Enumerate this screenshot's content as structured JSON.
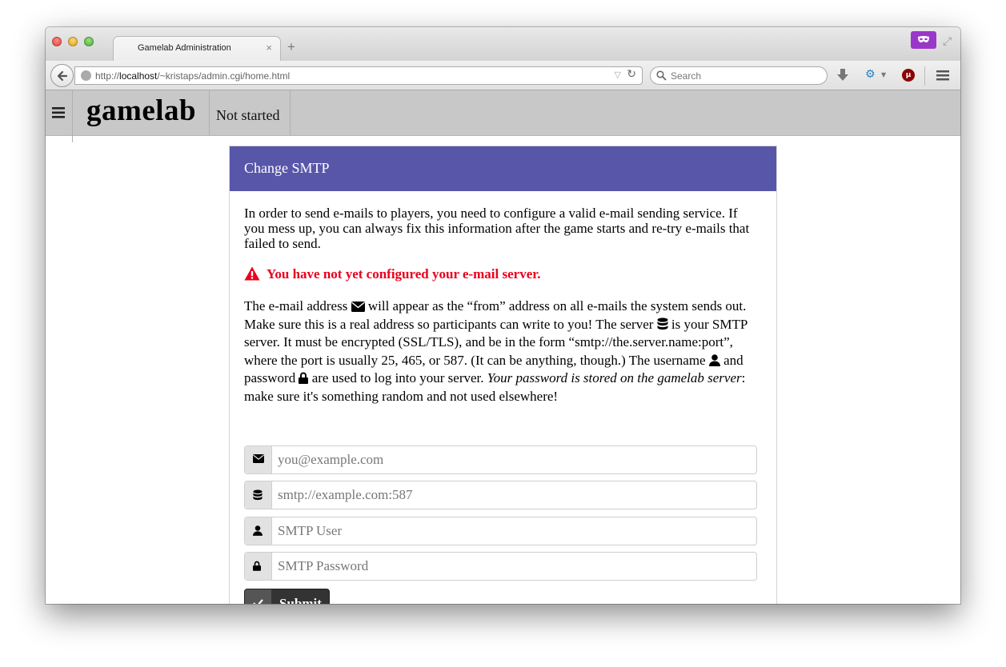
{
  "browser": {
    "tab_title": "Gamelab Administration",
    "tab_close": "×",
    "new_tab": "+",
    "url_prefix": "http://",
    "url_host": "localhost",
    "url_path": "/~kristaps/admin.cgi/home.html",
    "search_placeholder": "Search",
    "reload_glyph": "↻",
    "url_dropdown_glyph": "▽"
  },
  "app": {
    "title": "gamelab",
    "status": "Not started"
  },
  "panel": {
    "title": "Change SMTP",
    "intro": "In order to send e-mails to players, you need to configure a valid e-mail sending service. If you mess up, you can always fix this information after the game starts and re-try e-mails that failed to send.",
    "warning": "You have not yet configured your e-mail server.",
    "explain": {
      "p1": "The e-mail address",
      "p2": "will appear as the “from” address on all e-mails the system sends out. Make sure this is a real address so participants can write to you! The server",
      "p3": "is your SMTP server. It must be encrypted (SSL/TLS), and be in the form “smtp://the.server.name:port”, where the port is usually 25, 465, or 587. (It can be anything, though.) The username",
      "p4": "and password",
      "p5": "are used to log into your server.",
      "emph": "Your password is stored on the gamelab server",
      "p6": ": make sure it's something random and not used elsewhere!"
    },
    "fields": {
      "email": {
        "placeholder": "you@example.com",
        "value": "",
        "icon": "envelope-icon"
      },
      "server": {
        "placeholder": "smtp://example.com:587",
        "value": "",
        "icon": "database-icon"
      },
      "user": {
        "placeholder": "SMTP User",
        "value": "",
        "icon": "user-icon"
      },
      "password": {
        "placeholder": "SMTP Password",
        "value": "",
        "icon": "lock-icon"
      }
    },
    "submit_label": "Submit"
  },
  "colors": {
    "panel_header": "#5856a9",
    "warning": "#e8001c",
    "app_bar": "#c8c8c8",
    "button": "#333333"
  }
}
